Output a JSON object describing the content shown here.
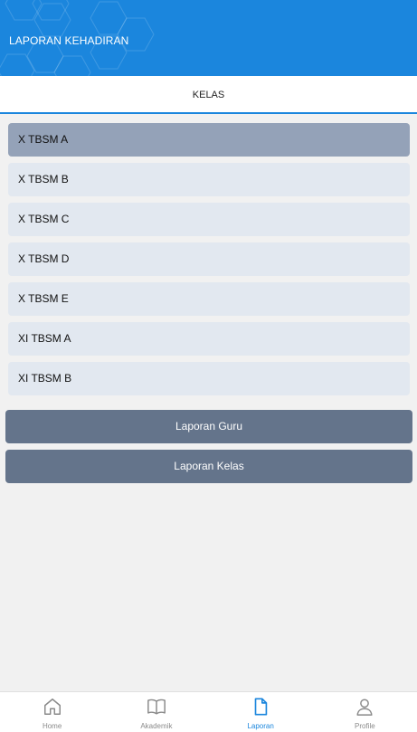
{
  "header": {
    "title": "LAPORAN KEHADIRAN"
  },
  "tabs": [
    {
      "label": "KELAS",
      "active": true
    }
  ],
  "class_list": {
    "selected_index": 0,
    "items": [
      {
        "label": "X TBSM A"
      },
      {
        "label": "X TBSM B"
      },
      {
        "label": "X TBSM C"
      },
      {
        "label": "X TBSM D"
      },
      {
        "label": "X TBSM E"
      },
      {
        "label": "XI TBSM A"
      },
      {
        "label": "XI TBSM B"
      }
    ]
  },
  "actions": {
    "laporan_guru": "Laporan Guru",
    "laporan_kelas": "Laporan Kelas"
  },
  "bottom_nav": {
    "items": [
      {
        "label": "Home",
        "icon": "home-icon",
        "active": false
      },
      {
        "label": "Akademik",
        "icon": "book-icon",
        "active": false
      },
      {
        "label": "Laporan",
        "icon": "document-icon",
        "active": true
      },
      {
        "label": "Profile",
        "icon": "user-icon",
        "active": false
      }
    ]
  },
  "colors": {
    "primary": "#1b86dd",
    "item_bg": "#e2e8f0",
    "item_selected_bg": "#94a2b8",
    "button_bg": "#64748b",
    "nav_inactive": "#8a8a8a"
  }
}
